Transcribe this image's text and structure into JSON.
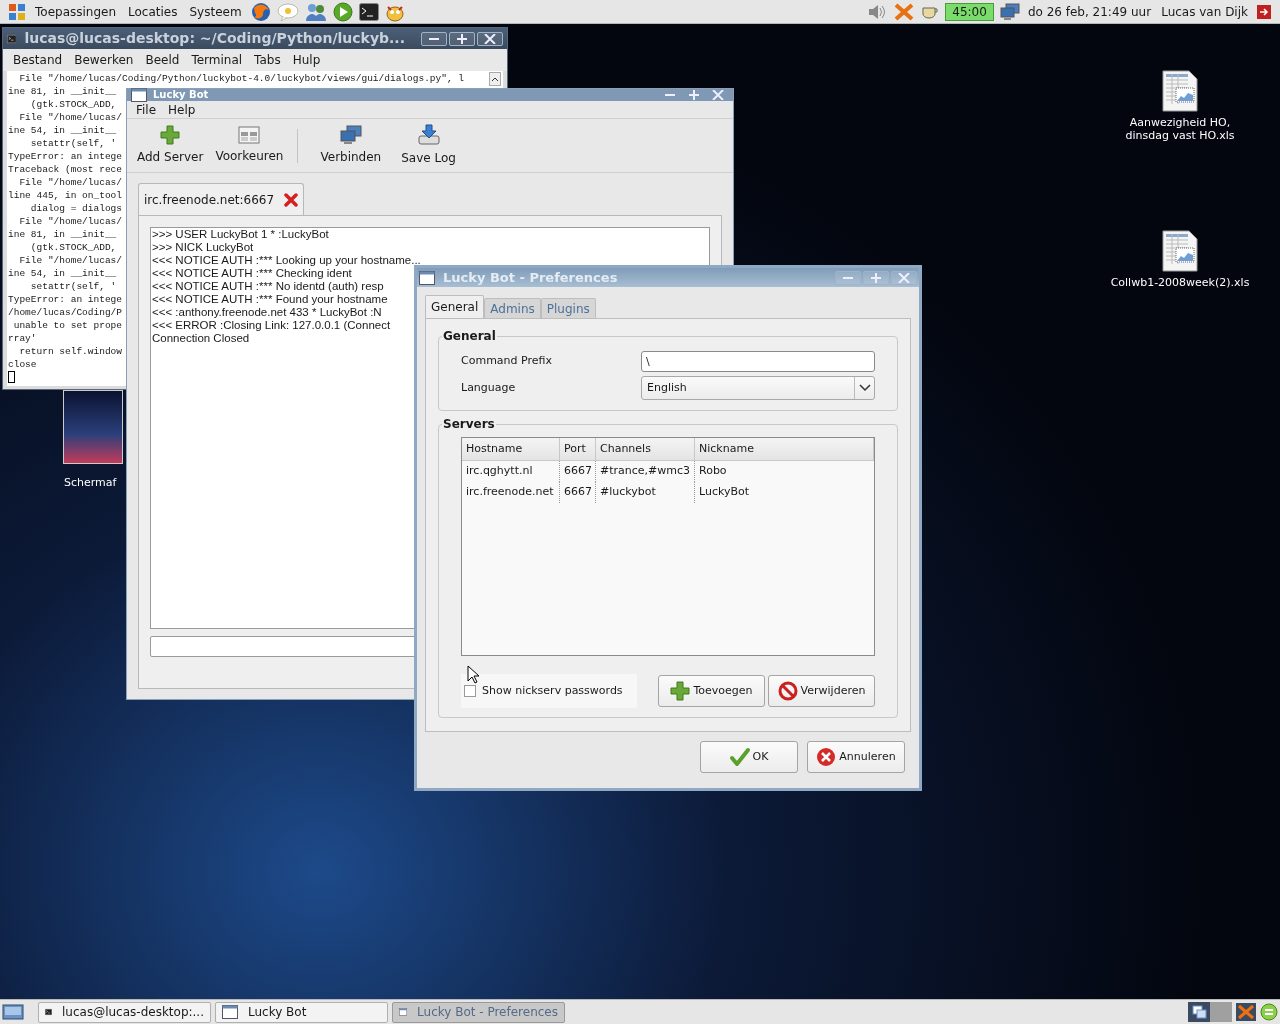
{
  "top_panel": {
    "menus": [
      "Toepassingen",
      "Locaties",
      "Systeem"
    ],
    "battery": "45:00",
    "clock": "do 26 feb, 21:49 uur",
    "user": "Lucas van Dijk"
  },
  "desktop_icons": [
    {
      "kind": "spreadsheet",
      "label": "Aanwezigheid HO, dinsdag vast HO.xls"
    },
    {
      "kind": "spreadsheet",
      "label": "Collwb1-2008week(2).xls"
    },
    {
      "kind": "image",
      "label": "Schermaf"
    }
  ],
  "terminal": {
    "title": "lucas@lucas-desktop: ~/Coding/Python/luckyb...",
    "menus": [
      "Bestand",
      "Bewerken",
      "Beeld",
      "Terminal",
      "Tabs",
      "Hulp"
    ],
    "lines": [
      "  File \"/home/lucas/Coding/Python/luckybot-4.0/luckybot/views/gui/dialogs.py\", l",
      "ine 81, in __init__",
      "    (gtk.STOCK_ADD,",
      "  File \"/home/lucas/",
      "ine 54, in __init__",
      "    setattr(self, '",
      "TypeError: an intege",
      "Traceback (most rece",
      "  File \"/home/lucas/",
      "line 445, in on_tool",
      "    dialog = dialogs",
      "  File \"/home/lucas/",
      "ine 81, in __init__",
      "    (gtk.STOCK_ADD,",
      "  File \"/home/lucas/",
      "ine 54, in __init__",
      "    setattr(self, '",
      "TypeError: an intege",
      "/home/lucas/Coding/P",
      " unable to set prope",
      "rray'",
      "  return self.window",
      "close"
    ]
  },
  "luckybot": {
    "title": "Lucky Bot",
    "menus": [
      "File",
      "Help"
    ],
    "toolbar": [
      {
        "kind": "add",
        "label": "Add Server"
      },
      {
        "kind": "prefs",
        "label": "Voorkeuren"
      },
      {
        "kind": "connect",
        "label": "Verbinden"
      },
      {
        "kind": "save",
        "label": "Save Log"
      }
    ],
    "tabs": [
      {
        "label": "irc.freenode.net:6667",
        "selected": true
      }
    ],
    "log": [
      ">>> USER LuckyBot 1 * :LuckyBot",
      ">>> NICK LuckyBot",
      "<<< NOTICE AUTH :*** Looking up your hostname...",
      "<<< NOTICE AUTH :*** Checking ident",
      "<<< NOTICE AUTH :*** No identd (auth) resp",
      "<<< NOTICE AUTH :*** Found your hostname",
      "<<< :anthony.freenode.net 433 * LuckyBot :N",
      "<<< ERROR :Closing Link: 127.0.0.1 (Connect",
      "Connection Closed"
    ]
  },
  "preferences": {
    "title": "Lucky Bot - Preferences",
    "tabs": [
      {
        "label": "General",
        "selected": true
      },
      {
        "label": "Admins",
        "selected": false
      },
      {
        "label": "Plugins",
        "selected": false
      }
    ],
    "general": {
      "heading": "General",
      "command_prefix": {
        "label": "Command Prefix",
        "value": "\\"
      },
      "language": {
        "label": "Language",
        "value": "English"
      }
    },
    "servers": {
      "heading": "Servers",
      "columns": [
        "Hostname",
        "Port",
        "Channels",
        "Nickname"
      ],
      "rows": [
        [
          "irc.qghytt.nl",
          "6667",
          "#trance,#wmc3",
          "Robo"
        ],
        [
          "irc.freenode.net",
          "6667",
          "#luckybot",
          "LuckyBot"
        ]
      ],
      "show_passwords": {
        "label": "Show nickserv passwords",
        "checked": false
      },
      "buttons": [
        {
          "kind": "add",
          "label": "Toevoegen"
        },
        {
          "kind": "remove",
          "label": "Verwijderen"
        }
      ]
    },
    "buttons": [
      {
        "kind": "ok",
        "label": "OK"
      },
      {
        "kind": "cancel",
        "label": "Annuleren"
      }
    ]
  },
  "taskbar": {
    "tasks": [
      {
        "kind": "terminal",
        "label": "lucas@lucas-desktop:...",
        "selected": false
      },
      {
        "kind": "window",
        "label": "Lucky Bot",
        "selected": false
      },
      {
        "kind": "window",
        "label": "Lucky Bot - Preferences",
        "selected": true
      }
    ]
  }
}
